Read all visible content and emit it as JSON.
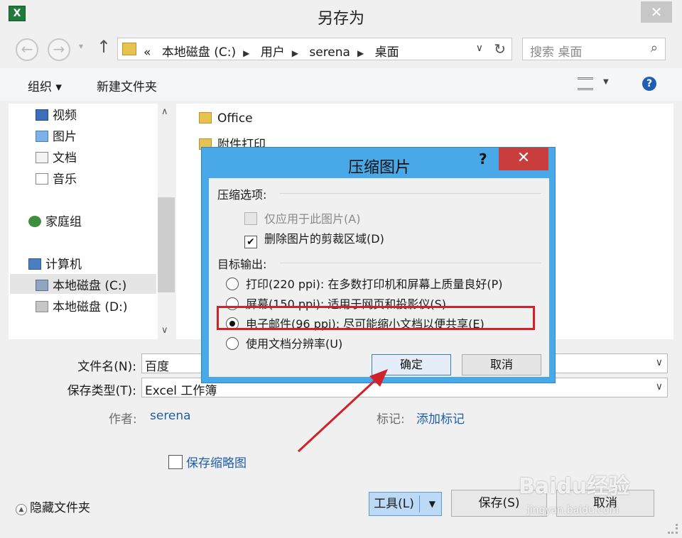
{
  "window": {
    "title": "另存为",
    "app_icon": "excel-icon",
    "close": "✕"
  },
  "nav": {
    "back": "←",
    "forward": "→",
    "recent": "▾",
    "up": "↑",
    "address": [
      "«",
      "本地磁盘 (C:)",
      "用户",
      "serena",
      "桌面"
    ],
    "search_placeholder": "搜索 桌面"
  },
  "toolbar": {
    "organize": "组织 ▾",
    "new_folder": "新建文件夹"
  },
  "tree": [
    {
      "label": "视频",
      "icon": "video-icon"
    },
    {
      "label": "图片",
      "icon": "pictures-icon"
    },
    {
      "label": "文档",
      "icon": "documents-icon"
    },
    {
      "label": "音乐",
      "icon": "music-icon"
    },
    {
      "label": "家庭组",
      "icon": "homegroup-icon"
    },
    {
      "label": "计算机",
      "icon": "computer-icon"
    },
    {
      "label": "本地磁盘 (C:)",
      "icon": "drive-c-icon",
      "selected": true
    },
    {
      "label": "本地磁盘 (D:)",
      "icon": "drive-d-icon"
    }
  ],
  "files": [
    {
      "label": "Office",
      "icon": "folder-icon"
    },
    {
      "label": "附件打印",
      "icon": "folder-icon"
    }
  ],
  "form": {
    "filename_label": "文件名(N):",
    "filename_value": "百度",
    "type_label": "保存类型(T):",
    "type_value": "Excel 工作簿",
    "author_label": "作者:",
    "author_value": "serena",
    "tags_label": "标记:",
    "tags_value": "添加标记",
    "thumbnail_label": "保存缩略图"
  },
  "footer": {
    "hide_folders": "隐藏文件夹",
    "tools": "工具(L)",
    "save": "保存(S)",
    "cancel": "取消"
  },
  "dialog": {
    "title": "压缩图片",
    "help": "?",
    "close": "✕",
    "section1": "压缩选项:",
    "opt_apply_only": "仅应用于此图片(A)",
    "opt_apply_only_checked": false,
    "opt_delete_crop": "删除图片的剪裁区域(D)",
    "opt_delete_crop_checked": true,
    "section2": "目标输出:",
    "targets": [
      {
        "label": "打印(220 ppi): 在多数打印机和屏幕上质量良好(P)",
        "selected": false
      },
      {
        "label": "屏幕(150 ppi): 适用于网页和投影仪(S)",
        "selected": false
      },
      {
        "label": "电子邮件(96 ppi): 尽可能缩小文档以便共享(E)",
        "selected": true
      },
      {
        "label": "使用文档分辨率(U)",
        "selected": false
      }
    ],
    "ok": "确定",
    "cancel": "取消"
  },
  "watermark": {
    "brand": "Baidu经验",
    "url": "jingyan.baidu.com"
  },
  "colors": {
    "dialog_frame": "#49a8e8",
    "close_red": "#c93d3d",
    "highlight_box": "#d0222a",
    "link_blue": "#1f5ea8"
  }
}
